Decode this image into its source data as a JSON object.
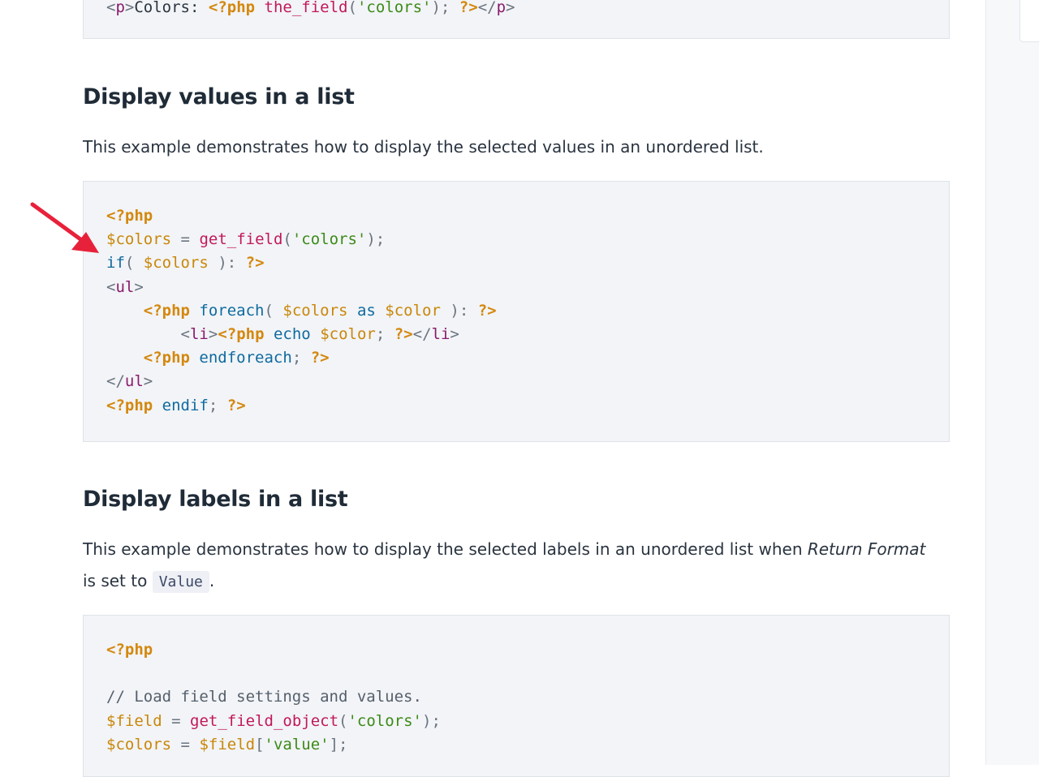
{
  "section_values": {
    "heading": "Display values in a list",
    "description": "This example demonstrates how to display the selected values in an unordered list."
  },
  "section_labels": {
    "heading": "Display labels in a list",
    "description_before": "This example demonstrates how to display the selected labels in an unordered list when",
    "description_em": "Return Format",
    "description_mid": "is set to",
    "inline_code": "Value",
    "description_after": "."
  },
  "code_top_partial": "<p>Colors: <?php the_field('colors'); ?></p>",
  "code_values_lines": [
    "<?php",
    "$colors = get_field('colors');",
    "if( $colors ): ?>",
    "<ul>",
    "    <?php foreach( $colors as $color ): ?>",
    "        <li><?php echo $color; ?></li>",
    "    <?php endforeach; ?>",
    "</ul>",
    "<?php endif; ?>"
  ],
  "code_labels_lines": [
    "<?php",
    "",
    "// Load field settings and values.",
    "$field = get_field_object('colors');",
    "$colors = $field['value'];"
  ],
  "colors": {
    "php_tag": "#d4880f",
    "variable": "#c9870a",
    "function": "#c2185b",
    "string": "#3c8a17",
    "html_tag": "#8b1a6b",
    "keyword": "#0f6a9f",
    "arrow": "#e8213a",
    "code_bg": "#f2f4f7"
  }
}
